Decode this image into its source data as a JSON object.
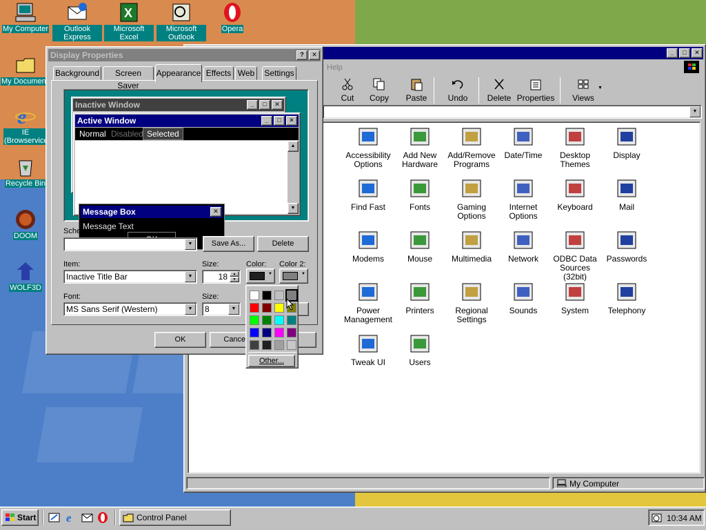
{
  "desktop": {
    "icons": [
      {
        "label": "My Computer"
      },
      {
        "label": "Outlook Express"
      },
      {
        "label": "Microsoft Excel"
      },
      {
        "label": "Microsoft Outlook"
      },
      {
        "label": "Opera"
      },
      {
        "label": "My Documents"
      },
      {
        "label": "IE (Browservice)"
      },
      {
        "label": "Recycle Bin"
      },
      {
        "label": "DOOM"
      },
      {
        "label": "WOLF3D"
      }
    ]
  },
  "control_panel": {
    "menu_partial": "Help",
    "toolbar": [
      {
        "label": "Cut",
        "icon": "scissors-icon"
      },
      {
        "label": "Copy",
        "icon": "copy-icon"
      },
      {
        "label": "Paste",
        "icon": "paste-icon"
      },
      {
        "label": "Undo",
        "icon": "undo-icon"
      },
      {
        "label": "Delete",
        "icon": "delete-icon"
      },
      {
        "label": "Properties",
        "icon": "properties-icon"
      },
      {
        "label": "Views",
        "icon": "views-icon"
      }
    ],
    "items": [
      {
        "label": "Accessibility Options"
      },
      {
        "label": "Add New Hardware"
      },
      {
        "label": "Add/Remove Programs"
      },
      {
        "label": "Date/Time"
      },
      {
        "label": "Desktop Themes"
      },
      {
        "label": "Display"
      },
      {
        "label": "Find Fast"
      },
      {
        "label": "Fonts"
      },
      {
        "label": "Gaming Options"
      },
      {
        "label": "Internet Options"
      },
      {
        "label": "Keyboard"
      },
      {
        "label": "Mail"
      },
      {
        "label": "Modems"
      },
      {
        "label": "Mouse"
      },
      {
        "label": "Multimedia"
      },
      {
        "label": "Network"
      },
      {
        "label": "ODBC Data Sources (32bit)"
      },
      {
        "label": "Passwords"
      },
      {
        "label": "Power Management"
      },
      {
        "label": "Printers"
      },
      {
        "label": "Regional Settings"
      },
      {
        "label": "Sounds"
      },
      {
        "label": "System"
      },
      {
        "label": "Telephony"
      },
      {
        "label": "Tweak UI"
      },
      {
        "label": "Users"
      }
    ],
    "status": "My Computer"
  },
  "display_properties": {
    "title": "Display Properties",
    "help_glyph": "?",
    "close_glyph": "✕",
    "tabs": [
      "Background",
      "Screen Saver",
      "Appearance",
      "Effects",
      "Web",
      "Settings"
    ],
    "active_tab": "Appearance",
    "preview": {
      "inactive_title": "Inactive Window",
      "active_title": "Active Window",
      "menu_normal": "Normal",
      "menu_disabled": "Disabled",
      "menu_selected": "Selected",
      "msgbox_title": "Message Box",
      "msgbox_text": "Message Text",
      "msgbox_ok": "OK"
    },
    "scheme_label": "Scheme:",
    "scheme_value": "",
    "save_as": "Save As...",
    "delete": "Delete",
    "item_label": "Item:",
    "item_value": "Inactive Title Bar",
    "size_label": "Size:",
    "size_value": "18",
    "color_label": "Color:",
    "color2_label": "Color 2:",
    "font_label": "Font:",
    "font_value": "MS Sans Serif (Western)",
    "font_size_label": "Size:",
    "font_size_value": "8",
    "ok": "OK",
    "cancel": "Cancel",
    "palette_other": "Other...",
    "palette_colors": [
      "#ffffff",
      "#000000",
      "#c0c0c0",
      "#808080",
      "#ff0000",
      "#800000",
      "#ffff00",
      "#808000",
      "#00ff00",
      "#008000",
      "#00ffff",
      "#008080",
      "#0000ff",
      "#000080",
      "#ff00ff",
      "#800080",
      "#404040",
      "#202020",
      "#a0a0a0",
      "#c8c8c8"
    ],
    "palette_selected_index": 3
  },
  "taskbar": {
    "start": "Start",
    "quick_launch": [
      "show-desktop-icon",
      "ie-icon",
      "outlook-express-icon",
      "opera-icon"
    ],
    "tasks": [
      {
        "label": "Control Panel"
      }
    ],
    "clock": "10:34 AM"
  },
  "colors": {
    "active_title": "#000080",
    "inactive_title": "#808080",
    "desktop_teal": "#008080",
    "face": "#c0c0c0"
  }
}
